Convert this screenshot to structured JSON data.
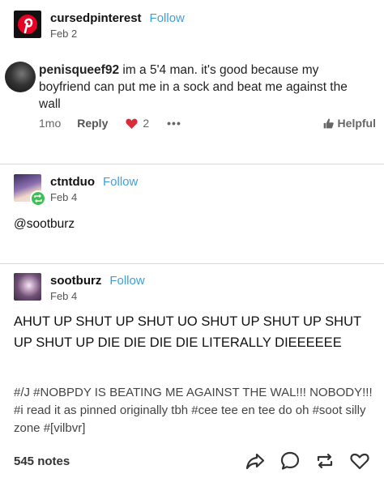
{
  "posts": [
    {
      "username": "cursedpinterest",
      "follow": "Follow",
      "date": "Feb 2"
    },
    {
      "username": "ctntduo",
      "follow": "Follow",
      "date": "Feb 4",
      "body": "@sootburz"
    },
    {
      "username": "sootburz",
      "follow": "Follow",
      "date": "Feb 4",
      "body": "AHUT UP SHUT UP SHUT UO SHUT UP SHUT UP SHUT UP SHUT UP DIE DIE DIE DIE LITERALLY DIEEEEEE",
      "tags": "#/J  #NOBPDY IS BEATING ME AGAINST THE WAL!!! NOBODY!!!  #i read it as pinned originally tbh  #cee tee en tee do oh  #soot silly zone  #[vilbvr]"
    }
  ],
  "comment": {
    "username": "penisqueef92",
    "text": "im a 5'4 man. it's good because my boyfriend can put me in a sock and beat me against the wall",
    "age": "1mo",
    "reply": "Reply",
    "likes": "2",
    "more": "•••",
    "helpful": "Helpful"
  },
  "footer": {
    "notes": "545 notes"
  },
  "colors": {
    "follow": "#3f9fdc",
    "pinterest": "#e60023",
    "heart": "#d92b3a",
    "reblog_badge": "#3fbf55"
  },
  "icons": [
    "pinterest-logo-icon",
    "heart-icon",
    "thumbs-up-icon",
    "reblog-badge-icon",
    "share-icon",
    "reply-icon",
    "reblog-icon",
    "like-icon"
  ]
}
